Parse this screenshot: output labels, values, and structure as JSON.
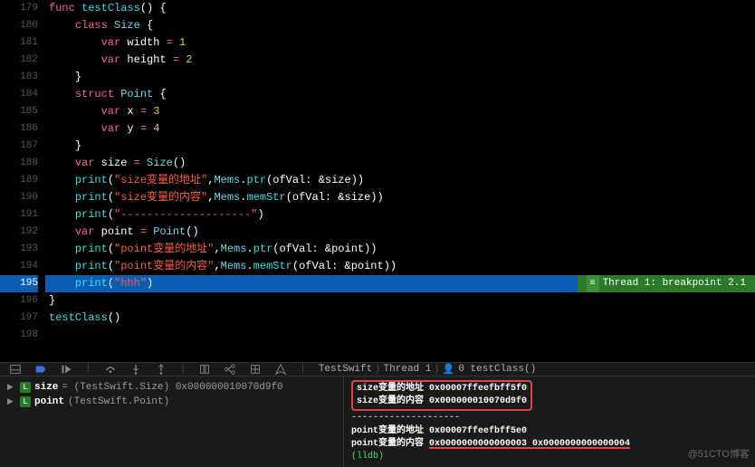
{
  "watermark": "@51CTO博客",
  "breakpoint_label": "Thread 1: breakpoint 2.1",
  "lines": [
    {
      "n": 179,
      "html": "<span class='kw'>func</span> <span class='fn'>testClass</span><span class='id'>()</span> <span class='id'>{</span>"
    },
    {
      "n": 180,
      "html": "    <span class='kw'>class</span> <span class='type'>Size</span> <span class='id'>{</span>"
    },
    {
      "n": 181,
      "html": "        <span class='kw'>var</span> <span class='id'>width</span> <span class='op'>=</span> <span class='num'>1</span>"
    },
    {
      "n": 182,
      "html": "        <span class='kw'>var</span> <span class='id'>height</span> <span class='op'>=</span> <span class='num'>2</span>"
    },
    {
      "n": 183,
      "html": "    <span class='id'>}</span>"
    },
    {
      "n": 184,
      "html": "    <span class='kw'>struct</span> <span class='type'>Point</span> <span class='id'>{</span>"
    },
    {
      "n": 185,
      "html": "        <span class='kw'>var</span> <span class='id'>x</span> <span class='op'>=</span> <span class='num'>3</span>"
    },
    {
      "n": 186,
      "html": "        <span class='kw'>var</span> <span class='id'>y</span> <span class='op'>=</span> <span class='num'>4</span>"
    },
    {
      "n": 187,
      "html": "    <span class='id'>}</span>"
    },
    {
      "n": 188,
      "html": "    <span class='kw'>var</span> <span class='id'>size</span> <span class='op'>=</span> <span class='type'>Size</span><span class='id'>()</span>"
    },
    {
      "n": 189,
      "html": "    <span class='fn'>print</span><span class='id'>(</span><span class='str'>\"size变量的地址\"</span><span class='id'>,</span><span class='type'>Mems</span><span class='id'>.</span><span class='fn'>ptr</span><span class='id'>(ofVal: &size))</span>"
    },
    {
      "n": 190,
      "html": "    <span class='fn'>print</span><span class='id'>(</span><span class='str'>\"size变量的内容\"</span><span class='id'>,</span><span class='type'>Mems</span><span class='id'>.</span><span class='fn'>memStr</span><span class='id'>(ofVal: &size))</span>"
    },
    {
      "n": 191,
      "html": "    <span class='fn'>print</span><span class='id'>(</span><span class='str'>\"--------------------\"</span><span class='id'>)</span>"
    },
    {
      "n": 192,
      "html": "    <span class='kw'>var</span> <span class='id'>point</span> <span class='op'>=</span> <span class='type'>Point</span><span class='id'>()</span>"
    },
    {
      "n": 193,
      "html": "    <span class='fn'>print</span><span class='id'>(</span><span class='str'>\"point变量的地址\"</span><span class='id'>,</span><span class='type'>Mems</span><span class='id'>.</span><span class='fn'>ptr</span><span class='id'>(ofVal: &point))</span>"
    },
    {
      "n": 194,
      "html": "    <span class='fn'>print</span><span class='id'>(</span><span class='str'>\"point变量的内容\"</span><span class='id'>,</span><span class='type'>Mems</span><span class='id'>.</span><span class='fn'>memStr</span><span class='id'>(ofVal: &point))</span>"
    },
    {
      "n": 195,
      "html": "    <span class='fn'>print</span><span class='id'>(</span><span class='str'>\"hhh\"</span><span class='id'>)</span>",
      "current": true
    },
    {
      "n": 196,
      "html": "<span class='id'>}</span>"
    },
    {
      "n": 197,
      "html": "<span class='fn'>testClass</span><span class='id'>()</span>"
    },
    {
      "n": 198,
      "html": ""
    }
  ],
  "breadcrumbs": {
    "project": "TestSwift",
    "thread": "Thread 1",
    "frame": "0 testClass()"
  },
  "vars": [
    {
      "name": "size",
      "value": "= (TestSwift.Size) 0x000000010070d9f0"
    },
    {
      "name": "point",
      "value": "(TestSwift.Point)"
    }
  ],
  "console": {
    "box1": [
      "size变量的地址 0x00007ffeefbff5f0",
      "size变量的内容 0x000000010070d9f0"
    ],
    "divider": "--------------------",
    "line3": "point变量的地址 0x00007ffeefbff5e0",
    "line4_prefix": "point变量的内容 ",
    "line4_underlined": "0x0000000000000003 0x0000000000000004",
    "prompt": "(lldb)"
  }
}
